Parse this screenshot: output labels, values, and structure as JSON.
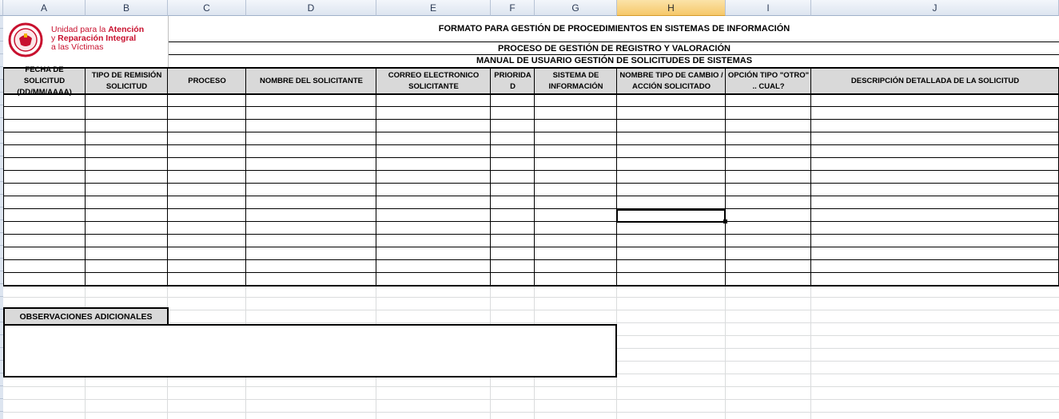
{
  "columns": [
    "A",
    "B",
    "C",
    "D",
    "E",
    "F",
    "G",
    "H",
    "I",
    "J"
  ],
  "active_column": "H",
  "logo": {
    "line1_prefix": "Unidad para la ",
    "line1_bold": "Atención",
    "line2_prefix": "y ",
    "line2_bold": "Reparación Integral",
    "line3": "a las Víctimas",
    "brand_color": "#c8102e",
    "seal_color": "#c8102e"
  },
  "titles": {
    "main": "FORMATO PARA GESTIÓN DE PROCEDIMIENTOS EN SISTEMAS DE INFORMACIÓN",
    "process": "PROCESO DE GESTIÓN DE REGISTRO Y VALORACIÓN",
    "manual": "MANUAL DE USUARIO GESTIÓN DE SOLICITUDES DE SISTEMAS"
  },
  "table": {
    "headers": [
      "FECHA DE SOLICITUD (DD/MM/AAAA)",
      "TIPO DE REMISIÓN SOLICITUD",
      "PROCESO",
      "NOMBRE DEL SOLICITANTE",
      "CORREO ELECTRONICO SOLICITANTE",
      "PRIORIDA D",
      "SISTEMA DE INFORMACIÓN",
      "NOMBRE TIPO DE CAMBIO / ACCIÓN SOLICITADO",
      "OPCIÓN TIPO \"OTRO\" .. CUAL?",
      "DESCRIPCIÓN DETALLADA DE LA SOLICITUD"
    ],
    "empty_rows": 15,
    "selected_cell": "H"
  },
  "observaciones": {
    "label": "OBSERVACIONES ADICIONALES",
    "value": ""
  },
  "colors": {
    "header_fill": "#d9d9d9",
    "selection_border": "#000000",
    "active_header": "#f6c86a"
  }
}
